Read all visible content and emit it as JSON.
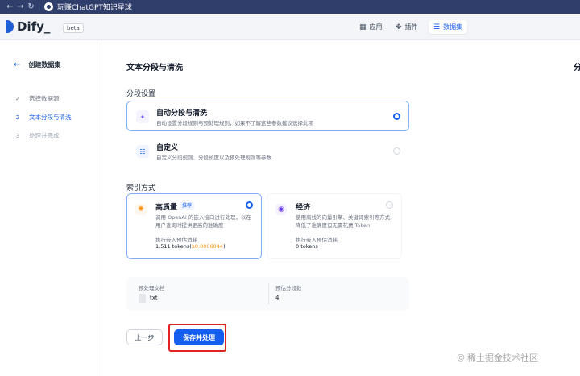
{
  "browser": {
    "tab_title": "玩赚ChatGPT知识星球"
  },
  "header": {
    "logo": "Dify_",
    "badge": "beta",
    "nav": [
      {
        "label": "应用",
        "icon": "grid-icon"
      },
      {
        "label": "插件",
        "icon": "puzzle-icon"
      },
      {
        "label": "数据集",
        "icon": "database-icon",
        "active": true
      }
    ]
  },
  "sidebar": {
    "back_label": "创建数据集",
    "steps": [
      {
        "num": "✓",
        "label": "选择数据源",
        "state": "done"
      },
      {
        "num": "2",
        "label": "文本分段与清洗",
        "state": "active"
      },
      {
        "num": "3",
        "label": "处理并完成",
        "state": "pending"
      }
    ]
  },
  "main": {
    "title": "文本分段与清洗",
    "right_fragment": "分",
    "segment_section": "分段设置",
    "segment_options": [
      {
        "title": "自动分段与清洗",
        "desc": "自动设置分段规则与预处理规则，如果不了解这些参数建议选择此项",
        "selected": true
      },
      {
        "title": "自定义",
        "desc": "自定义分段规则、分段长度以及预处理规则等参数",
        "selected": false
      }
    ],
    "index_section": "索引方式",
    "index_options": {
      "high_quality": {
        "title": "高质量",
        "badge": "推荐",
        "desc": "调用 OpenAI 的嵌入接口进行处理，以在用户查询时提供更高的准确度",
        "cost_label": "执行嵌入预估消耗",
        "cost_prefix": "1,511 tokens(",
        "cost_price": "$0.0006044",
        "cost_suffix": ")",
        "selected": true
      },
      "economy": {
        "title": "经济",
        "desc": "使用离线的向量引擎、关键词索引等方式，降低了准确度但无需花费 Token",
        "cost_label": "执行嵌入预估消耗",
        "cost_value": "0 tokens",
        "selected": false
      }
    },
    "preview": {
      "doc_label": "预处理文档",
      "doc_name": "txt",
      "segments_label": "预估分段数",
      "segments_value": "4"
    },
    "buttons": {
      "prev": "上一步",
      "save": "保存并处理"
    },
    "watermark": "稀土掘金技术社区"
  }
}
